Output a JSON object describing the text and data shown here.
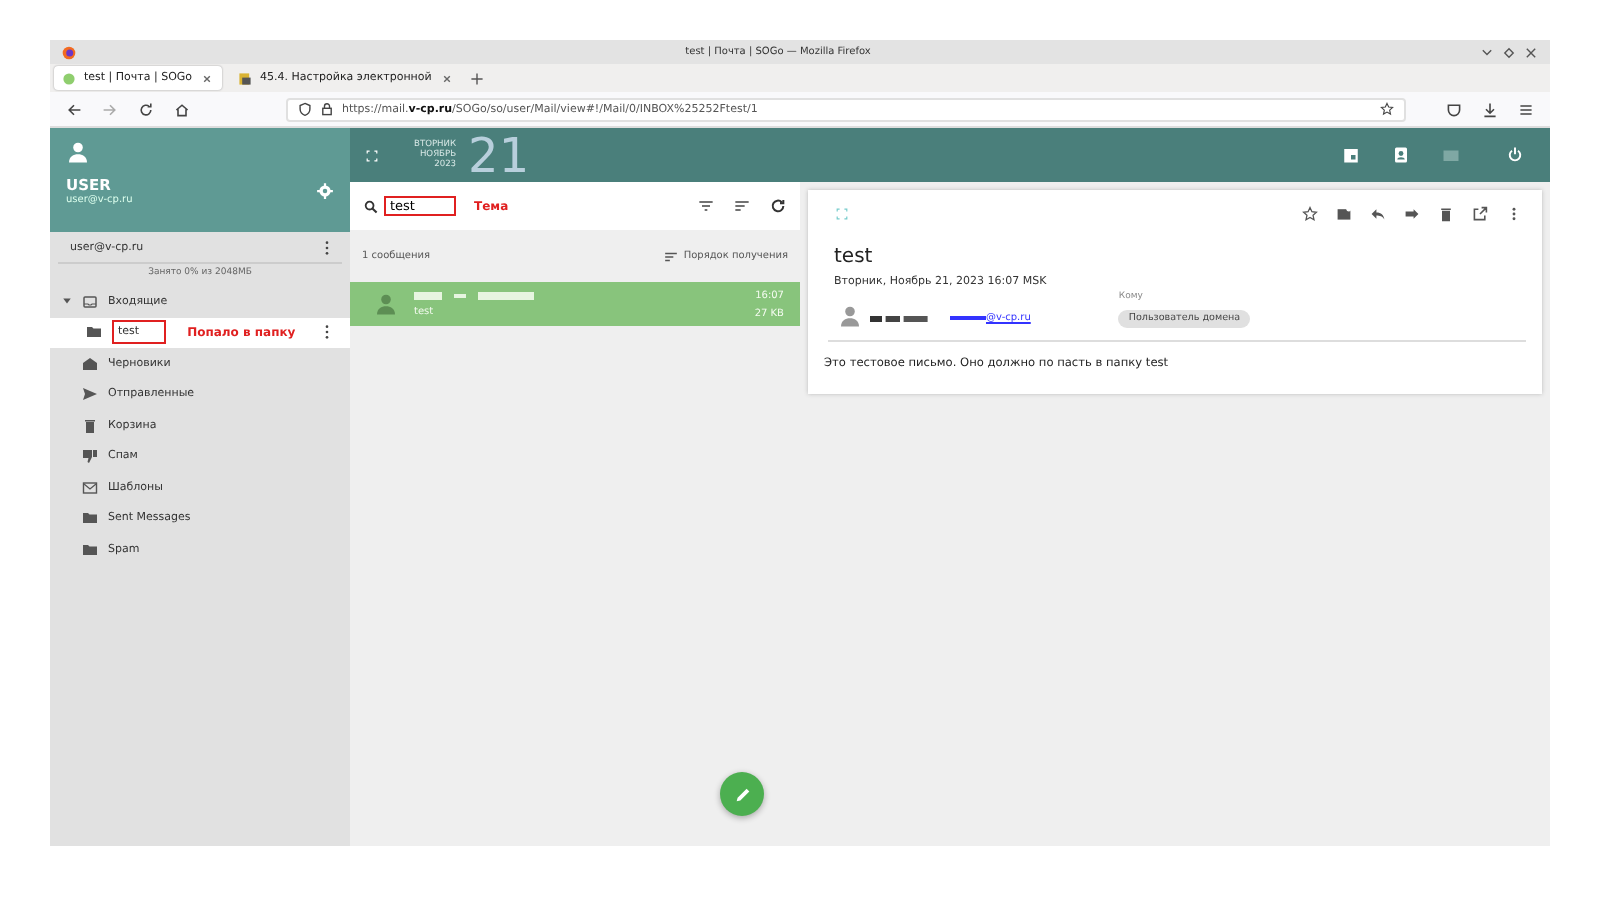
{
  "window": {
    "title": "test | Почта | SOGo — Mozilla Firefox"
  },
  "browser": {
    "tabs": [
      {
        "label": "test | Почта | SOGo",
        "selected": true,
        "kind": "site"
      },
      {
        "label": "45.4. Настройка электронной",
        "selected": false,
        "kind": "document"
      }
    ],
    "url_prefix": "https://mail.",
    "url_domain": "v-cp.ru",
    "url_path": "/SOGo/so/user/Mail/view#!/Mail/0/INBOX%25252Ftest/1"
  },
  "sidebar": {
    "user": {
      "name": "USER",
      "email": "user@v-cp.ru"
    },
    "account": "user@v-cp.ru",
    "quota": "Занято 0% из 2048МБ",
    "folders": [
      {
        "label": "Входящие",
        "kind": "inbox",
        "expanded": true,
        "children": [
          {
            "label": "test",
            "kind": "folder",
            "selected": true,
            "annotation": "Попало в папку"
          }
        ]
      },
      {
        "label": "Черновики",
        "kind": "drafts",
        "selected": false
      },
      {
        "label": "Отправленные",
        "kind": "sent",
        "selected": false
      },
      {
        "label": "Корзина",
        "kind": "trash",
        "selected": false
      },
      {
        "label": "Спам",
        "kind": "spam",
        "selected": false
      },
      {
        "label": "Шаблоны",
        "kind": "templates",
        "selected": false
      },
      {
        "label": "Sent Messages",
        "kind": "folder",
        "selected": false
      },
      {
        "label": "Spam",
        "kind": "folder",
        "selected": false
      }
    ]
  },
  "header": {
    "weekday": "ВТОРНИК",
    "month": "НОЯБРЬ",
    "year": "2023",
    "day": "21"
  },
  "list": {
    "search": {
      "value": "test",
      "annotation": "Тема"
    },
    "count": "1 сообщения",
    "sort": "Порядок получения",
    "messages": [
      {
        "subject": "test",
        "time": "16:07",
        "size": "27 KB",
        "selected": true
      }
    ]
  },
  "viewer": {
    "subject": "test",
    "date": "Вторник, Ноябрь 21, 2023 16:07 MSK",
    "sender_email_tail": "@v-cp.ru",
    "to_label": "Кому",
    "recipient": "Пользователь домена",
    "body": "Это тестовое письмо. Оно должно по пасть в папку test"
  }
}
